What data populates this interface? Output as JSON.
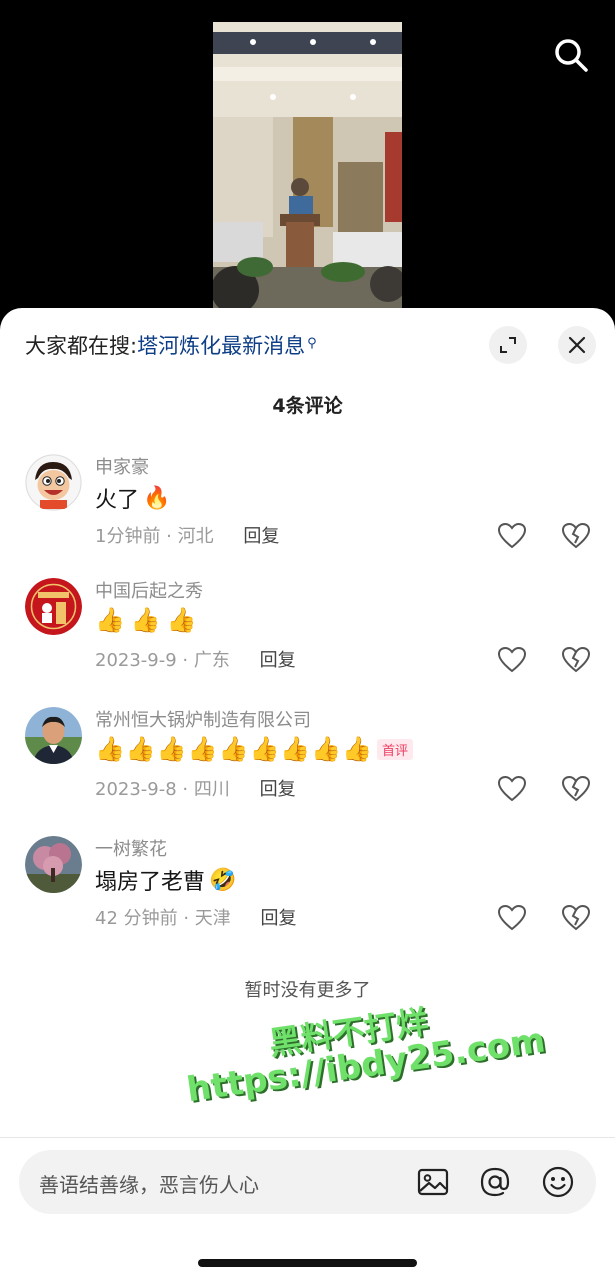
{
  "hot_search": {
    "prefix": "大家都在搜:",
    "query": "塔河炼化最新消息",
    "search_mark": "⚲"
  },
  "comments_title": "4条评论",
  "comments": [
    {
      "name": "申家豪",
      "text": "火了",
      "emoji": "🔥",
      "meta": "1分钟前 · 河北",
      "reply": "回复",
      "avatar": "cartoon-boy-avatar"
    },
    {
      "name": "中国后起之秀",
      "text": "",
      "thumbs": 3,
      "meta": "2023-9-9 · 广东",
      "reply": "回复",
      "avatar": "red-emblem-avatar"
    },
    {
      "name": "常州恒大锅炉制造有限公司",
      "text": "",
      "thumbs": 9,
      "badge": "首评",
      "meta": "2023-9-8 · 四川",
      "reply": "回复",
      "avatar": "man-portrait-avatar"
    },
    {
      "name": "一树繁花",
      "text": "塌房了老曹",
      "emoji": "🤣",
      "meta": "42 分钟前 · 天津",
      "reply": "回复",
      "avatar": "flower-tree-avatar"
    }
  ],
  "no_more": "暂时没有更多了",
  "watermark": {
    "line1": "黑料不打烊",
    "line2": "https://ibdy25.com"
  },
  "input": {
    "placeholder": "善语结善缘，恶言伤人心"
  },
  "colors": {
    "link": "#0e3e86",
    "badge": "#ee3d62",
    "watermark": "#6fe06a"
  }
}
